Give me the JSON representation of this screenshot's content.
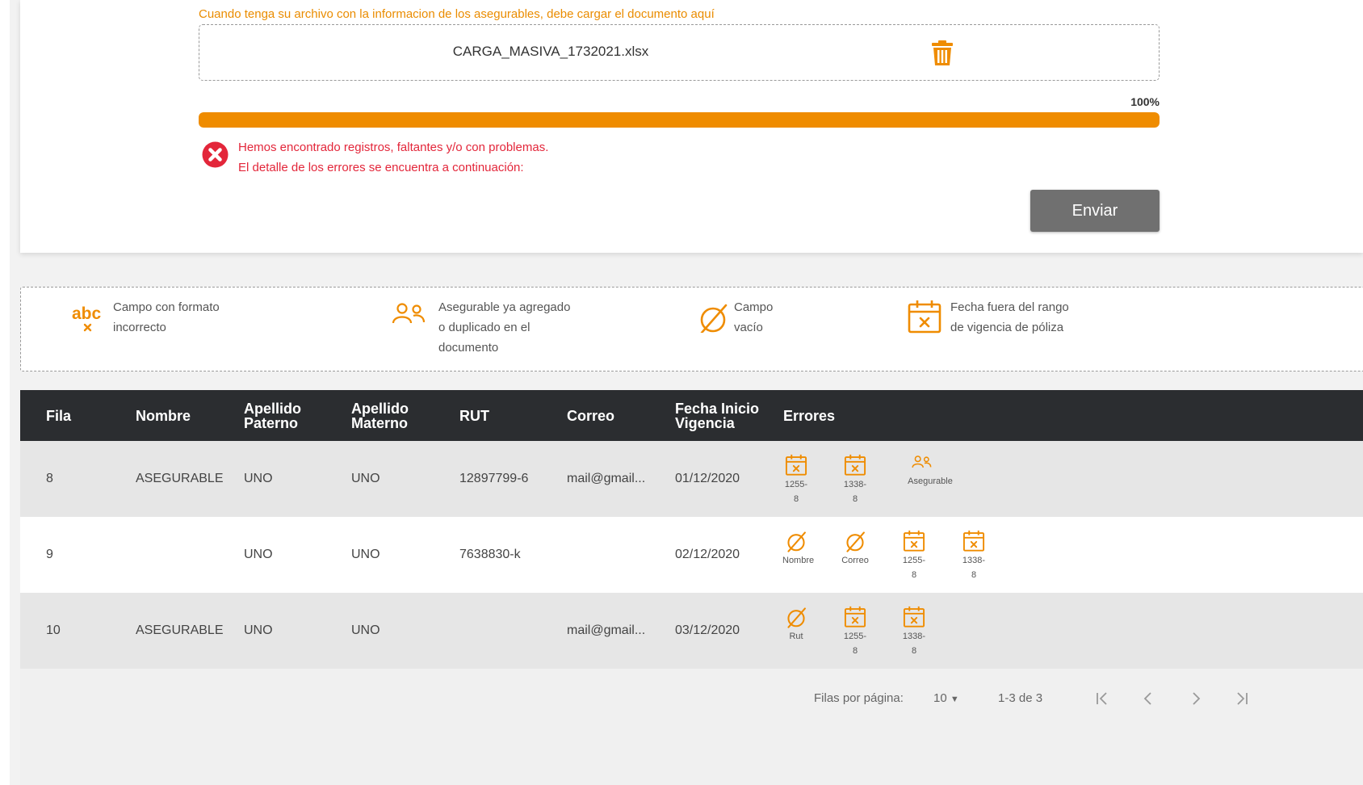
{
  "upload": {
    "instruction": "Cuando tenga su archivo con la informacion de los asegurables, debe cargar el documento aquí",
    "filename": "CARGA_MASIVA_1732021.xlsx",
    "progress_percent": 100,
    "progress_label": "100%",
    "error_line1": "Hemos encontrado registros, faltantes y/o con problemas.",
    "error_line2": "El detalle de los errores se encuentra a continuación:",
    "send_label": "Enviar"
  },
  "colors": {
    "accent": "#ef8c00",
    "error": "#e3263a",
    "header": "#2b2d30",
    "button": "#707070"
  },
  "legend": [
    {
      "icon": "abc-format-icon",
      "text": "Campo con formato\nincorrecto"
    },
    {
      "icon": "duplicate-users-icon",
      "text": "Asegurable ya agregado\no duplicado en el\ndocumento"
    },
    {
      "icon": "empty-field-icon",
      "text": "Campo\nvacío"
    },
    {
      "icon": "calendar-x-icon",
      "text": "Fecha fuera del rango\nde vigencia de póliza"
    }
  ],
  "table": {
    "headers": [
      "Fila",
      "Nombre",
      "Apellido Paterno",
      "Apellido Materno",
      "RUT",
      "Correo",
      "Fecha Inicio Vigencia",
      "Errores"
    ],
    "rows": [
      {
        "fila": "8",
        "nombre": "ASEGURABLE",
        "paterno": "UNO",
        "materno": "UNO",
        "rut": "12897799-6",
        "correo": "mail@gmail...",
        "fecha": "01/12/2020",
        "errores": [
          {
            "icon": "calendar-x-icon",
            "label": "1255-8"
          },
          {
            "icon": "calendar-x-icon",
            "label": "1338-8"
          },
          {
            "icon": "duplicate-users-icon",
            "label": "Asegurable"
          }
        ]
      },
      {
        "fila": "9",
        "nombre": "",
        "paterno": "UNO",
        "materno": "UNO",
        "rut": "7638830-k",
        "correo": "",
        "fecha": "02/12/2020",
        "errores": [
          {
            "icon": "empty-field-icon",
            "label": "Nombre"
          },
          {
            "icon": "empty-field-icon",
            "label": "Correo"
          },
          {
            "icon": "calendar-x-icon",
            "label": "1255-8"
          },
          {
            "icon": "calendar-x-icon",
            "label": "1338-8"
          }
        ]
      },
      {
        "fila": "10",
        "nombre": "ASEGURABLE",
        "paterno": "UNO",
        "materno": "UNO",
        "rut": "",
        "correo": "mail@gmail...",
        "fecha": "03/12/2020",
        "errores": [
          {
            "icon": "empty-field-icon",
            "label": "Rut"
          },
          {
            "icon": "calendar-x-icon",
            "label": "1255-8"
          },
          {
            "icon": "calendar-x-icon",
            "label": "1338-8"
          }
        ]
      }
    ]
  },
  "pagination": {
    "rows_per_page_label": "Filas por página:",
    "rows_per_page": "10",
    "range": "1-3 de 3"
  }
}
